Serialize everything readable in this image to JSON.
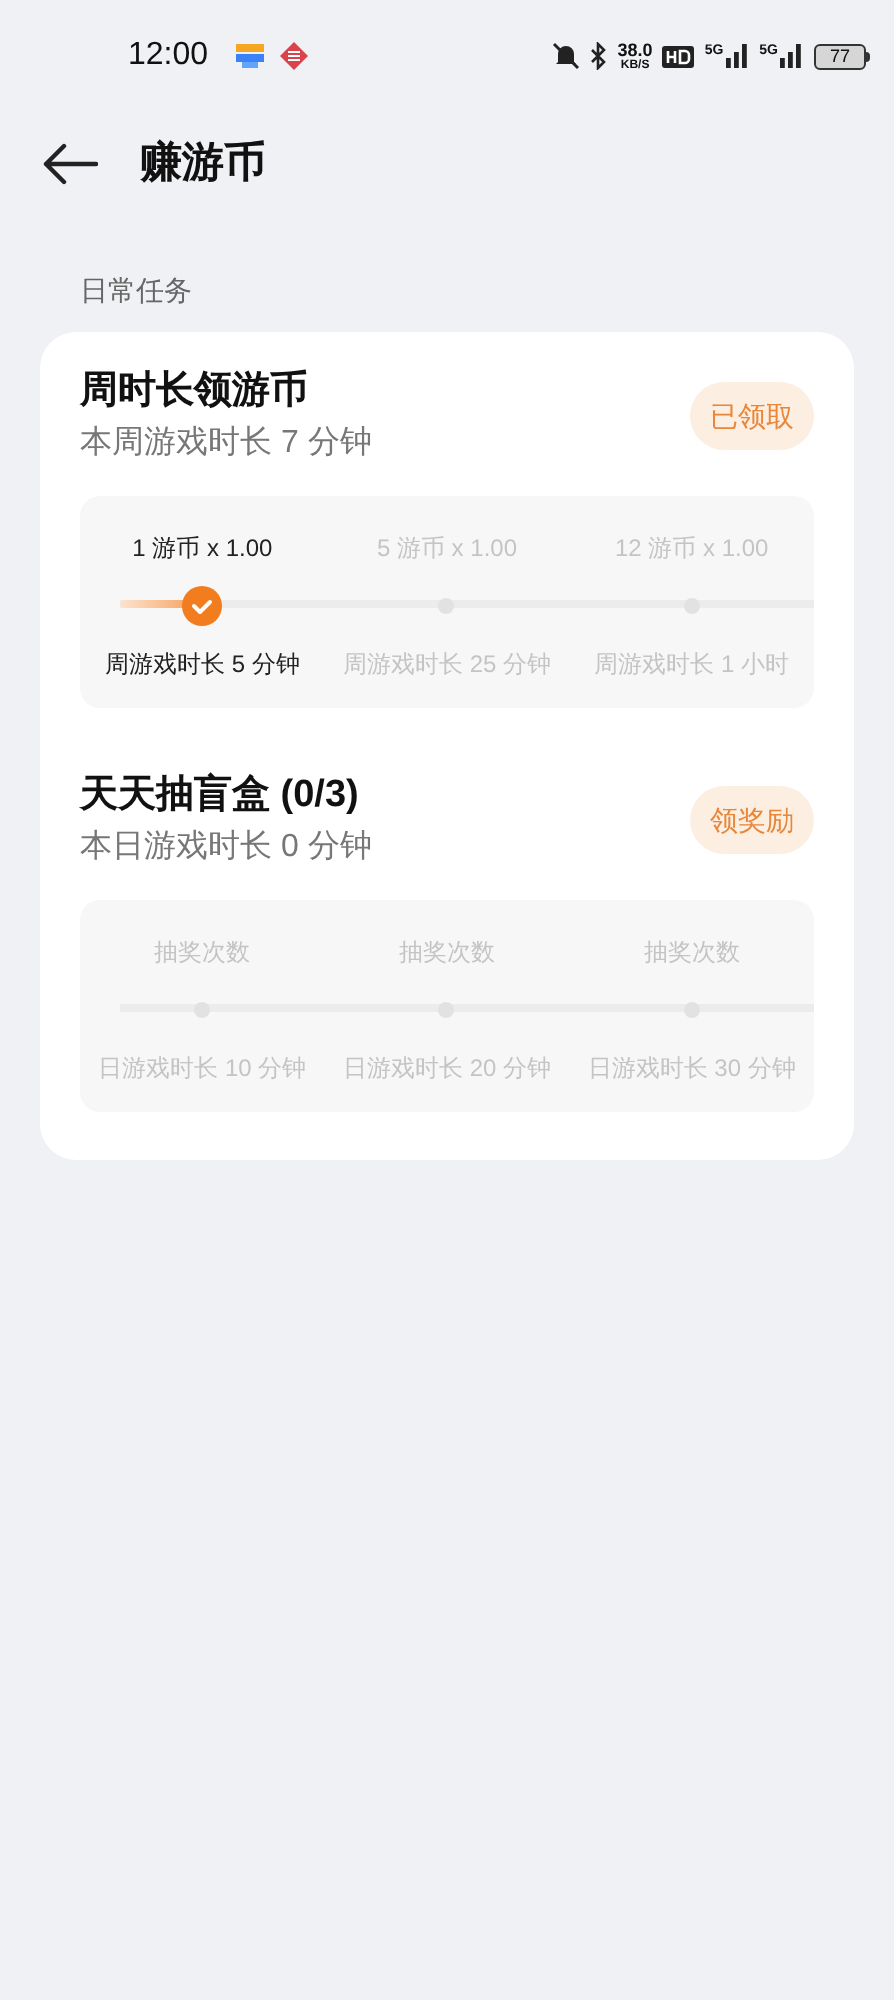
{
  "status_bar": {
    "time": "12:00",
    "speed": "38.0",
    "speed_unit": "KB/S",
    "network_1": "5G",
    "network_2": "5G",
    "battery": "77"
  },
  "header": {
    "title": "赚游币"
  },
  "section": {
    "title": "日常任务"
  },
  "tasks": [
    {
      "title": "周时长领游币",
      "subtitle": "本周游戏时长 7 分钟",
      "button": {
        "label": "已领取",
        "disabled": true
      },
      "level": 0.12,
      "milestones": [
        {
          "reward": "1 游币 x 1.00",
          "requirement": "周游戏时长 5 分钟",
          "reached": true
        },
        {
          "reward": "5 游币 x 1.00",
          "requirement": "周游戏时长 25 分钟",
          "reached": false
        },
        {
          "reward": "12 游币 x 1.00",
          "requirement": "周游戏时长 1 小时",
          "reached": false
        }
      ]
    },
    {
      "title": "天天抽盲盒 (0/3)",
      "subtitle": "本日游戏时长 0 分钟",
      "button": {
        "label": "领奖励",
        "disabled": true
      },
      "level": 0,
      "milestones": [
        {
          "reward": "抽奖次数",
          "requirement": "日游戏时长 10 分钟",
          "reached": false
        },
        {
          "reward": "抽奖次数",
          "requirement": "日游戏时长 20 分钟",
          "reached": false
        },
        {
          "reward": "抽奖次数",
          "requirement": "日游戏时长 30 分钟",
          "reached": false
        }
      ]
    }
  ]
}
